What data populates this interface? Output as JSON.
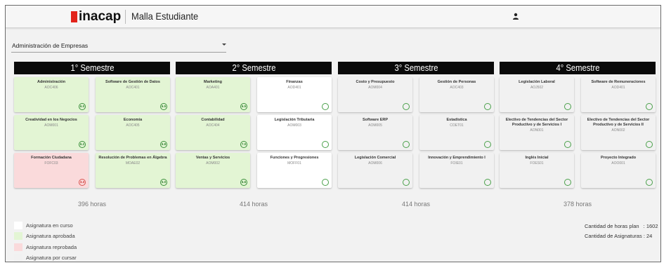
{
  "header": {
    "logo_text": "inacap",
    "title": "Malla Estudiante",
    "user_icon": "user-icon"
  },
  "career": {
    "selected": "Administración de Empresas"
  },
  "colors": {
    "approved": "#e3f5d4",
    "failed": "#fadadb",
    "pending": "#f1f1f1",
    "current": "#ffffff",
    "brand": "#e2231a"
  },
  "semesters": [
    {
      "title": "1° Semestre",
      "hours": "396 horas",
      "courses": [
        {
          "name": "Administración",
          "code": "AOC406",
          "status": "approved",
          "grade": "6.0"
        },
        {
          "name": "Software de Gestión de Datos",
          "code": "AOC401",
          "status": "approved",
          "grade": "6.5"
        },
        {
          "name": "Creatividad en los Negocios",
          "code": "AOM001",
          "status": "approved",
          "grade": "6.2"
        },
        {
          "name": "Economía",
          "code": "AOC405",
          "status": "approved",
          "grade": "6.8"
        },
        {
          "name": "Formación Ciudadana",
          "code": "FOFC03",
          "status": "failed",
          "grade": "3.3"
        },
        {
          "name": "Resolución de Problemas en Álgebra",
          "code": "MOAE02",
          "status": "approved",
          "grade": "5.0"
        }
      ]
    },
    {
      "title": "2° Semestre",
      "hours": "414 horas",
      "courses": [
        {
          "name": "Marketing",
          "code": "AOA401",
          "status": "approved",
          "grade": "6.5"
        },
        {
          "name": "Finanzas",
          "code": "AOD401",
          "status": "current",
          "grade": ""
        },
        {
          "name": "Contabilidad",
          "code": "AOC404",
          "status": "approved",
          "grade": "7.0"
        },
        {
          "name": "Legislación Tributaria",
          "code": "AOM003",
          "status": "current",
          "grade": ""
        },
        {
          "name": "Ventas y Servicios",
          "code": "AOM002",
          "status": "approved",
          "grade": "6.6"
        },
        {
          "name": "Funciones y Progresiones",
          "code": "MOFF01",
          "status": "current",
          "grade": ""
        }
      ]
    },
    {
      "title": "3° Semestre",
      "hours": "414 horas",
      "courses": [
        {
          "name": "Costo y Presupuesto",
          "code": "AOM004",
          "status": "pending",
          "grade": ""
        },
        {
          "name": "Gestión de Personas",
          "code": "AOC403",
          "status": "pending",
          "grade": ""
        },
        {
          "name": "Software ERP",
          "code": "AOM005",
          "status": "pending",
          "grade": ""
        },
        {
          "name": "Estadística",
          "code": "COET01",
          "status": "pending",
          "grade": ""
        },
        {
          "name": "Legislación Comercial",
          "code": "AOM006",
          "status": "pending",
          "grade": ""
        },
        {
          "name": "Innovación y Emprendimiento I",
          "code": "FOIE01",
          "status": "pending",
          "grade": ""
        }
      ]
    },
    {
      "title": "4° Semestre",
      "hours": "378 horas",
      "courses": [
        {
          "name": "Legislación Laboral",
          "code": "AOJ502",
          "status": "pending",
          "grade": ""
        },
        {
          "name": "Software de Remuneraciones",
          "code": "AOD401",
          "status": "pending",
          "grade": ""
        },
        {
          "name": "Electivo de Tendencias del Sector Productivo y de Servicios I",
          "code": "AON001",
          "status": "pending",
          "grade": ""
        },
        {
          "name": "Electivo de Tendencias del Sector Productivo y de Servicios II",
          "code": "AON002",
          "status": "pending",
          "grade": ""
        },
        {
          "name": "Inglés Inicial",
          "code": "FOES01",
          "status": "pending",
          "grade": ""
        },
        {
          "name": "Proyecto Integrado",
          "code": "AOO001",
          "status": "pending",
          "grade": ""
        }
      ]
    }
  ],
  "legend": [
    {
      "label": "Asignatura en curso",
      "status": "current"
    },
    {
      "label": "Asignatura aprobada",
      "status": "approved"
    },
    {
      "label": "Asignatura reprobada",
      "status": "failed"
    },
    {
      "label": "Asignatura por cursar",
      "status": "pending"
    }
  ],
  "stats": {
    "hours_label": "Cantidad de horas plan",
    "hours_value": ": 1602",
    "courses_label": "Cantidad de Asignaturas",
    "courses_value": ": 24"
  }
}
